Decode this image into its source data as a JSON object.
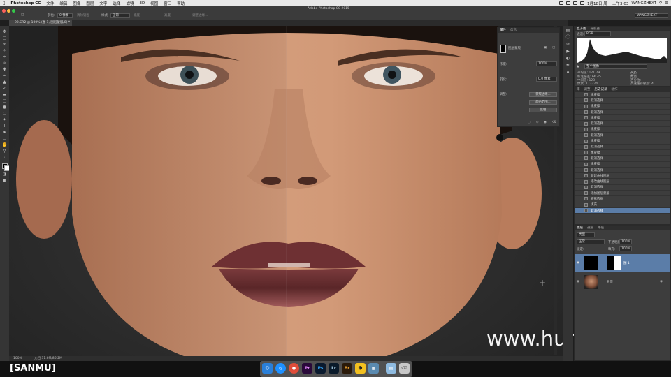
{
  "menubar": {
    "app": "Photoshop CC",
    "menus": [
      "文件",
      "编辑",
      "图像",
      "图层",
      "文字",
      "选择",
      "滤镜",
      "3D",
      "视图",
      "窗口",
      "帮助"
    ],
    "clock": "1月18日 周一 上午3:03",
    "user": "WANGZHEXT"
  },
  "optbar": {
    "window_title": "Adobe Photoshop CC 2015",
    "feather_label": "羽化:",
    "feather_value": "0 像素",
    "antialias": "消除锯齿",
    "style_label": "样式:",
    "style_value": "正常",
    "width_label": "宽度:",
    "height_label": "高度:",
    "refine_edge": "调整边缘...",
    "workspace": "WANGZHEXT"
  },
  "document": {
    "tab_title": "92.CR2 @ 100% (图 1, 图层蒙版/8) *"
  },
  "properties": {
    "tabs": [
      "属性",
      "信息"
    ],
    "mask_title": "图层蒙版",
    "density_label": "浓度:",
    "density_value": "100%",
    "feather_label": "羽化:",
    "feather_value": "0.0 像素",
    "refine_label": "调整:",
    "buttons": [
      "蒙版边缘...",
      "颜色范围...",
      "反相"
    ]
  },
  "histogram": {
    "tabs": [
      "直方图",
      "导航器"
    ],
    "channel_label": "通道:",
    "channel_value": "RGB",
    "source": "整个图像",
    "stats": [
      "平均值: 121.79",
      "标准偏差: 66.45",
      "中间值: 128",
      "像素: 173724"
    ],
    "stats2": [
      "色阶:",
      "数量:",
      "百分位:",
      "高速缓存级别: 4"
    ]
  },
  "history": {
    "tabs": [
      "库",
      "调整",
      "历史记录",
      "动作"
    ],
    "items": [
      "橡皮擦",
      "取消选择",
      "橡皮擦",
      "取消选择",
      "橡皮擦",
      "取消选择",
      "橡皮擦",
      "取消选择",
      "橡皮擦",
      "取消选择",
      "橡皮擦",
      "取消选择",
      "橡皮擦",
      "取消选择",
      "新建曲线图层",
      "修改曲线图层",
      "取消选择",
      "添加图层蒙版",
      "矩形选框",
      "填充",
      "取消选择"
    ]
  },
  "layers": {
    "tabs": [
      "图层",
      "通道",
      "路径"
    ],
    "kind": "类型",
    "blend_mode": "正常",
    "opacity_label": "不透明度:",
    "opacity_value": "100%",
    "lock_label": "锁定:",
    "fill_label": "填充:",
    "fill_value": "100%",
    "items": [
      {
        "name": "图 1"
      },
      {
        "name": "背景"
      }
    ]
  },
  "status": {
    "zoom": "100%",
    "doc_size": "文档:31.6M/86.2M"
  },
  "watermark": "www.hunls.com",
  "corner_label": "[SANMU]",
  "dock_apps": [
    "Finder",
    "Safari",
    "Chrome",
    "Pr",
    "Ps",
    "Lr",
    "Br",
    "QQ",
    "Preview",
    "Folder",
    "Trash"
  ],
  "colors": {
    "accent": "#5b7da8",
    "panel": "#3d3d3d",
    "canvas_bg": "#2a2a2a"
  }
}
